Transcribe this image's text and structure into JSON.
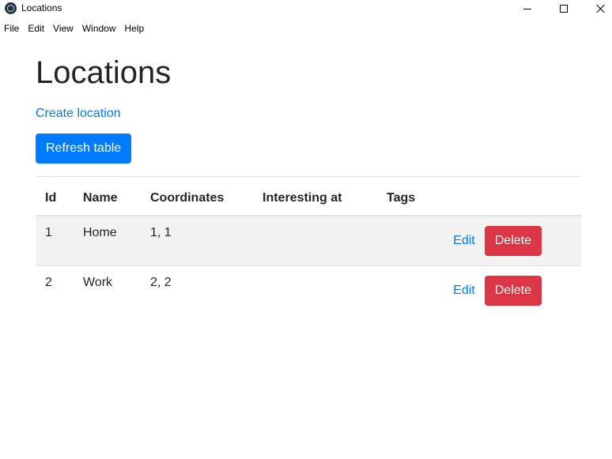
{
  "window": {
    "title": "Locations"
  },
  "menu": {
    "items": [
      "File",
      "Edit",
      "View",
      "Window",
      "Help"
    ]
  },
  "page": {
    "title": "Locations",
    "create_link": "Create location",
    "refresh_button": "Refresh table"
  },
  "table": {
    "headers": [
      "Id",
      "Name",
      "Coordinates",
      "Interesting at",
      "Tags"
    ],
    "rows": [
      {
        "id": "1",
        "name": "Home",
        "coordinates": "1, 1",
        "interesting_at": "",
        "tags": "",
        "edit": "Edit",
        "delete": "Delete"
      },
      {
        "id": "2",
        "name": "Work",
        "coordinates": "2, 2",
        "interesting_at": "",
        "tags": "",
        "edit": "Edit",
        "delete": "Delete"
      }
    ]
  },
  "colors": {
    "primary": "#007bff",
    "danger": "#dc3545",
    "row_stripe": "#f2f2f2"
  }
}
